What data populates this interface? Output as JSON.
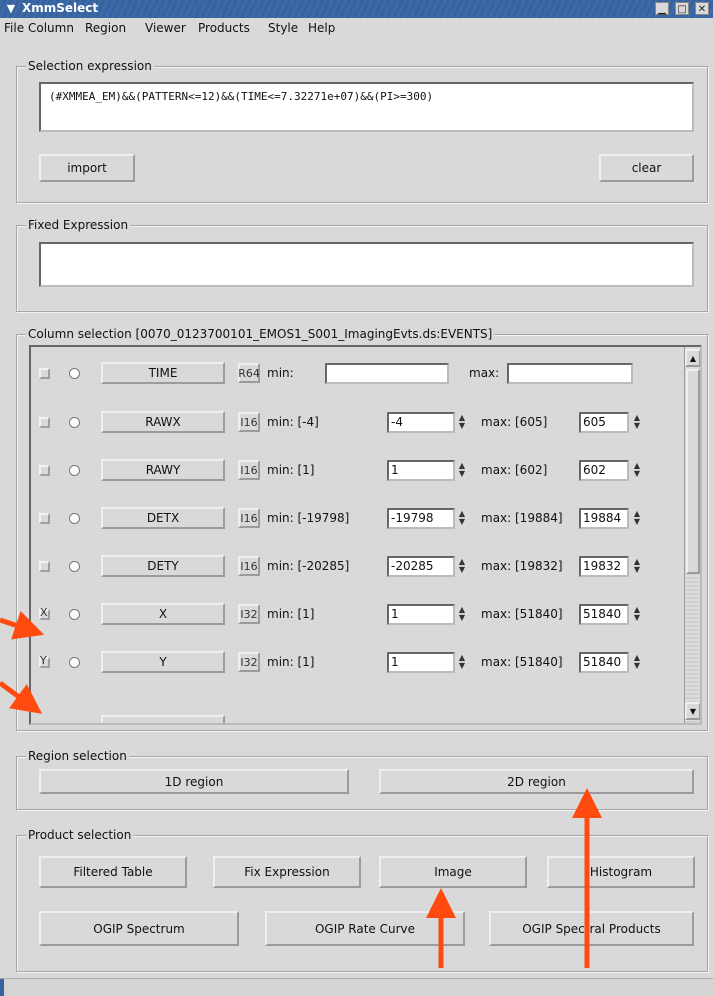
{
  "window": {
    "title": "XmmSelect",
    "minimize": "▁",
    "maximize": "□",
    "close": "✕",
    "sysmenu": "▼"
  },
  "menu": [
    "File",
    "Column",
    "Region",
    "Viewer",
    "Products",
    "Style",
    "Help"
  ],
  "selection": {
    "label": "Selection expression",
    "expression": "(#XMMEA_EM)&&(PATTERN<=12)&&(TIME<=7.32271e+07)&&(PI>=300)",
    "import": "import",
    "clear": "clear"
  },
  "fixed": {
    "label": "Fixed Expression",
    "value": ""
  },
  "columns": {
    "label": "Column selection [0070_0123700101_EMOS1_S001_ImagingEvts.ds:EVENTS]",
    "rows": [
      {
        "name": "TIME",
        "type": "R64",
        "min_label": "min:",
        "min": "",
        "max_label": "max:",
        "max": "",
        "checked": "",
        "plain": true
      },
      {
        "name": "RAWX",
        "type": "I16",
        "min_label": "min: [-4]",
        "min": "-4",
        "max_label": "max: [605]",
        "max": "605",
        "checked": ""
      },
      {
        "name": "RAWY",
        "type": "I16",
        "min_label": "min: [1]",
        "min": "1",
        "max_label": "max: [602]",
        "max": "602",
        "checked": ""
      },
      {
        "name": "DETX",
        "type": "I16",
        "min_label": "min: [-19798]",
        "min": "-19798",
        "max_label": "max: [19884]",
        "max": "19884",
        "checked": ""
      },
      {
        "name": "DETY",
        "type": "I16",
        "min_label": "min: [-20285]",
        "min": "-20285",
        "max_label": "max: [19832]",
        "max": "19832",
        "checked": ""
      },
      {
        "name": "X",
        "type": "I32",
        "min_label": "min: [1]",
        "min": "1",
        "max_label": "max: [51840]",
        "max": "51840",
        "checked": "X"
      },
      {
        "name": "Y",
        "type": "I32",
        "min_label": "min: [1]",
        "min": "1",
        "max_label": "max: [51840]",
        "max": "51840",
        "checked": "Y"
      }
    ]
  },
  "region": {
    "label": "Region selection",
    "btn1d": "1D region",
    "btn2d": "2D region"
  },
  "products": {
    "label": "Product selection",
    "row1": [
      "Filtered Table",
      "Fix Expression",
      "Image",
      "Histogram"
    ],
    "row2": [
      "OGIP Spectrum",
      "OGIP Rate Curve",
      "OGIP Spectral Products"
    ]
  },
  "colors": {
    "annotation_arrow": "#ff4a10",
    "titlebar": "#3563a0"
  }
}
